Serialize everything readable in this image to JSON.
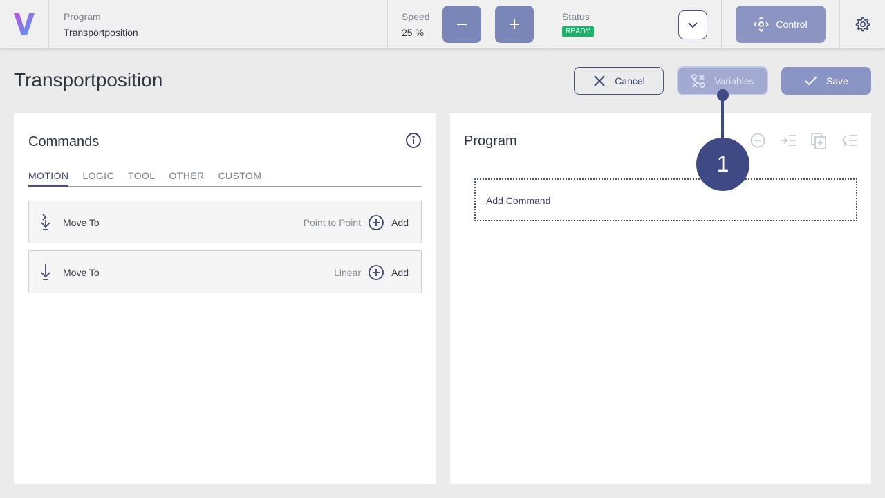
{
  "header": {
    "program_label": "Program",
    "program_value": "Transportposition",
    "speed_label": "Speed",
    "speed_value": "25 %",
    "status_label": "Status",
    "status_value": "READY",
    "control_label": "Control"
  },
  "page": {
    "title": "Transportposition",
    "cancel_label": "Cancel",
    "variables_label": "Variables",
    "save_label": "Save"
  },
  "commands": {
    "title": "Commands",
    "tabs": [
      "MOTION",
      "LOGIC",
      "TOOL",
      "OTHER",
      "CUSTOM"
    ],
    "active_tab": "MOTION",
    "items": [
      {
        "name": "Move To",
        "type": "Point to Point",
        "action": "Add"
      },
      {
        "name": "Move To",
        "type": "Linear",
        "action": "Add"
      }
    ]
  },
  "program": {
    "title": "Program",
    "add_command_label": "Add Command"
  },
  "annotation": {
    "number": "1"
  },
  "colors": {
    "accent": "#4a5280",
    "button_fill": "#7b86b8",
    "status_ready": "#19b36b",
    "callout": "#3f4a85"
  },
  "icons": [
    "logo-icon",
    "minus-icon",
    "plus-icon",
    "chevron-down-icon",
    "move-arrows-icon",
    "gear-icon",
    "close-icon",
    "variables-icon",
    "check-icon",
    "info-icon",
    "move-to-icon",
    "add-circle-icon",
    "remove-circle-icon",
    "indent-icon",
    "duplicate-icon",
    "outdent-icon"
  ]
}
